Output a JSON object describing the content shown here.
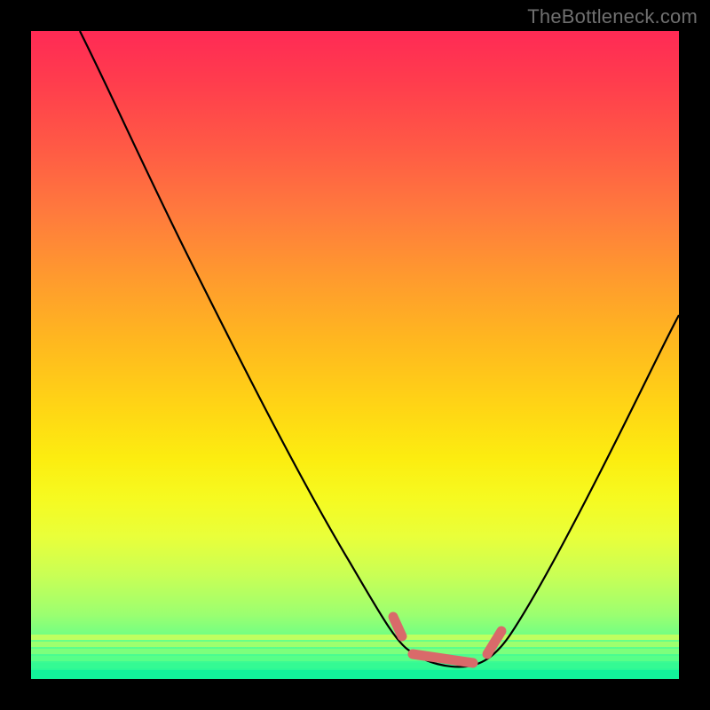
{
  "watermark": "TheBottleneck.com",
  "chart_data": {
    "type": "line",
    "title": "",
    "xlabel": "",
    "ylabel": "",
    "xlim": [
      0,
      100
    ],
    "ylim": [
      0,
      100
    ],
    "grid": false,
    "legend": false,
    "background": {
      "type": "vertical-gradient",
      "stops": [
        {
          "pos": 0,
          "color": "#ff2a55"
        },
        {
          "pos": 50,
          "color": "#ffd515"
        },
        {
          "pos": 75,
          "color": "#f6fa20"
        },
        {
          "pos": 100,
          "color": "#17f59a"
        }
      ]
    },
    "series": [
      {
        "name": "bottleneck-curve",
        "color": "#000000",
        "x": [
          8,
          15,
          25,
          35,
          45,
          53,
          57,
          60,
          63,
          67,
          70,
          74,
          78,
          85,
          92,
          100
        ],
        "y": [
          100,
          88,
          70,
          52,
          33,
          17,
          9,
          5,
          3,
          2,
          3,
          6,
          12,
          25,
          40,
          58
        ]
      }
    ],
    "valley_marker": {
      "color": "#e57373",
      "segments": [
        {
          "x1": 56,
          "y1": 10,
          "x2": 57.5,
          "y2": 7
        },
        {
          "x1": 60,
          "y1": 4,
          "x2": 68.5,
          "y2": 3.5
        },
        {
          "x1": 71,
          "y1": 5,
          "x2": 73,
          "y2": 8
        }
      ]
    },
    "near_bottom_bands": {
      "colors": [
        "#9cff70",
        "#5dff8d",
        "#17f59a"
      ],
      "y_positions": [
        92,
        95,
        98
      ]
    }
  }
}
